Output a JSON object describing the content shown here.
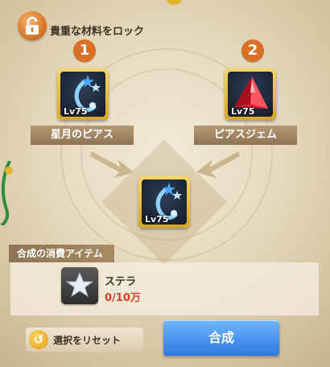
{
  "lock": {
    "title": "貴重な材料をロック",
    "icon": "padlock-icon"
  },
  "materials": [
    {
      "number": "1",
      "level": "Lv75",
      "name": "星月のピアス",
      "icon": "star-moon-earring-icon"
    },
    {
      "number": "2",
      "level": "Lv75",
      "name": "ピアスジェム",
      "icon": "red-gem-icon"
    }
  ],
  "result": {
    "level": "Lv75",
    "icon": "star-moon-earring-icon"
  },
  "consume": {
    "title": "合成の消費アイテム",
    "item_name": "ステラ",
    "count": "0/10万",
    "icon": "silver-star-icon"
  },
  "actions": {
    "reset_label": "選択をリセット",
    "synthesize_label": "合成"
  },
  "colors": {
    "accent_orange": "#d97026",
    "button_blue": "#3a86ea",
    "count_red": "#d2462e"
  }
}
